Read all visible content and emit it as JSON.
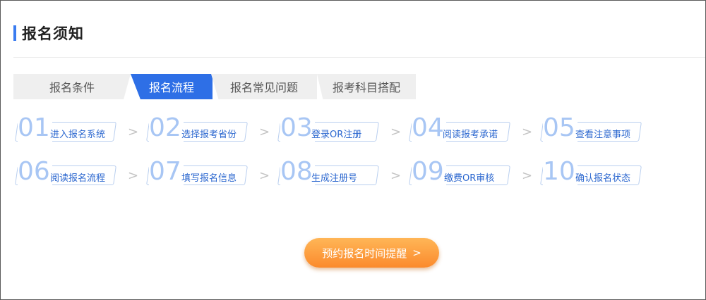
{
  "header": {
    "title": "报名须知"
  },
  "tabs": [
    {
      "label": "报名条件"
    },
    {
      "label": "报名流程"
    },
    {
      "label": "报名常见问题"
    },
    {
      "label": "报考科目搭配"
    }
  ],
  "steps": [
    {
      "num": "01",
      "label": "进入报名系统"
    },
    {
      "num": "02",
      "label": "选择报考省份"
    },
    {
      "num": "03",
      "label": "登录OR注册"
    },
    {
      "num": "04",
      "label": "阅读报考承诺"
    },
    {
      "num": "05",
      "label": "查看注意事项"
    },
    {
      "num": "06",
      "label": "阅读报名流程"
    },
    {
      "num": "07",
      "label": "填写报名信息"
    },
    {
      "num": "08",
      "label": "生成注册号"
    },
    {
      "num": "09",
      "label": "缴费OR审核"
    },
    {
      "num": "10",
      "label": "确认报名状态"
    }
  ],
  "arrow_glyph": ">",
  "cta": {
    "label": "预约报名时间提醒",
    "chevron": ">"
  }
}
